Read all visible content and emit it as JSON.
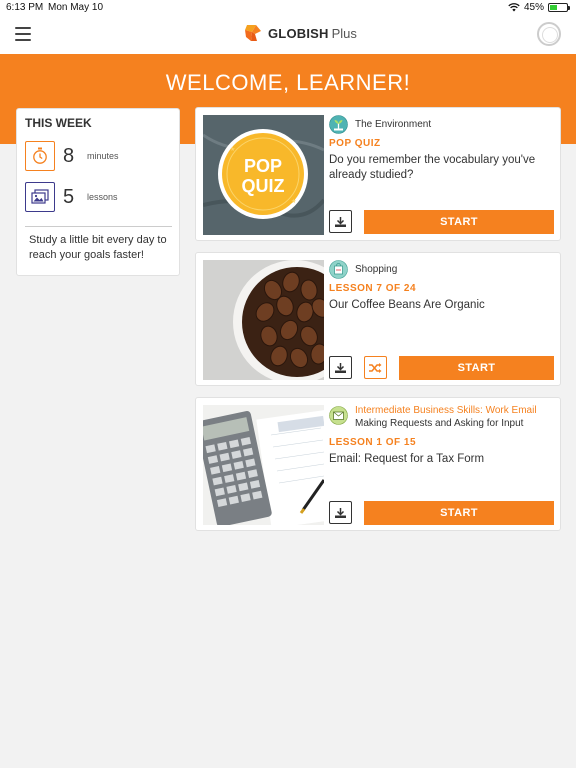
{
  "status_bar": {
    "time": "6:13 PM",
    "date": "Mon May 10",
    "battery_percent_label": "45%",
    "battery_level": 0.45
  },
  "app": {
    "brand_name": "GLOBISH",
    "brand_suffix": "Plus",
    "welcome": "WELCOME, LEARNER!"
  },
  "this_week": {
    "title": "THIS WEEK",
    "minutes_value": "8",
    "minutes_unit": "minutes",
    "lessons_value": "5",
    "lessons_unit": "lessons",
    "tip": "Study a little bit every day to reach your goals faster!"
  },
  "cards": [
    {
      "topic": "The Environment",
      "label": "POP QUIZ",
      "description": "Do you remember the vocabulary you've already studied?",
      "badge_line1": "POP",
      "badge_line2": "QUIZ",
      "start_label": "START"
    },
    {
      "topic": "Shopping",
      "label": "LESSON 7 OF 24",
      "description": "Our Coffee Beans Are Organic",
      "start_label": "START"
    },
    {
      "topic": "Intermediate Business Skills: Work Email",
      "subtopic": "Making Requests and Asking for Input",
      "label": "LESSON 1 OF 15",
      "description": "Email: Request for a Tax Form",
      "start_label": "START"
    }
  ],
  "colors": {
    "accent": "#f5811f",
    "purple": "#3d3a8c",
    "background": "#f2f2f2"
  },
  "icons": [
    "hamburger-icon",
    "globish-logo-icon",
    "progress-ring-icon",
    "stopwatch-icon",
    "lessons-icon",
    "download-icon",
    "shuffle-icon",
    "wifi-icon",
    "battery-icon"
  ]
}
